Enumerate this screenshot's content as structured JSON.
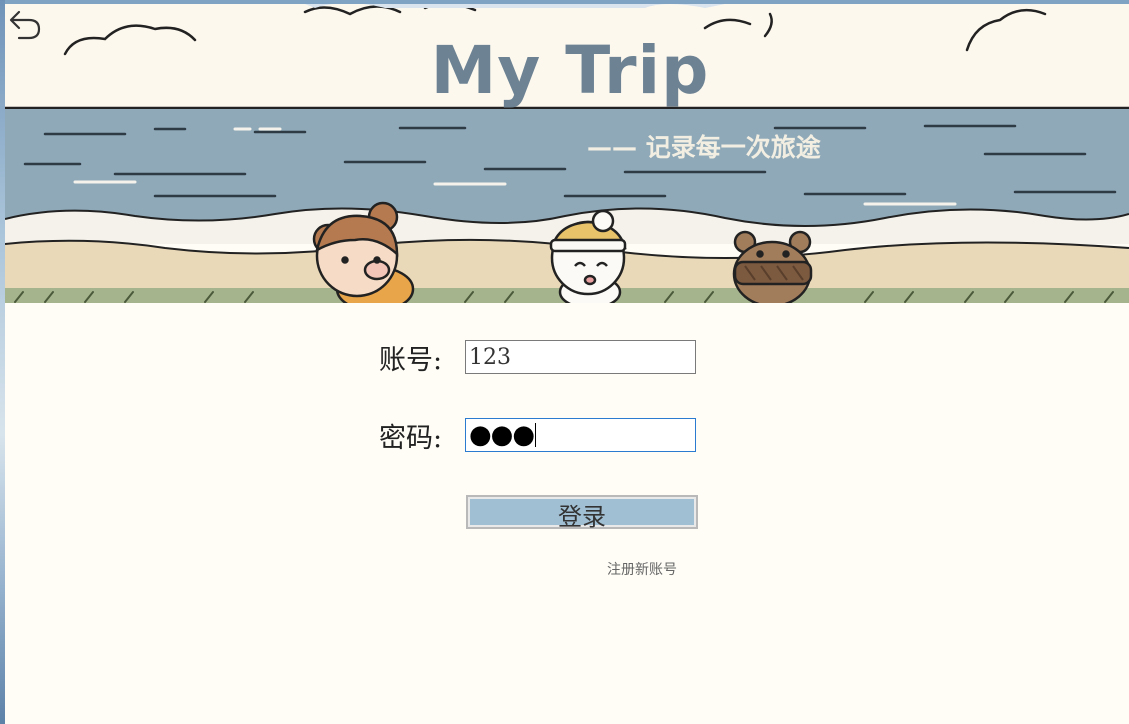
{
  "banner": {
    "title": "My Trip",
    "subtitle": "—— 记录每一次旅途"
  },
  "login_form": {
    "account_label": "账号:",
    "account_value": "123",
    "password_label": "密码:",
    "password_mask": "●●●",
    "login_label": "登录",
    "register_label": "注册新账号"
  },
  "icons": {
    "back": "back-arrow-icon"
  },
  "colors": {
    "page_bg": "#fffdf6",
    "button_bg": "#a0bfd3",
    "focus_border": "#2b7bd0",
    "title": "#6d8394"
  }
}
